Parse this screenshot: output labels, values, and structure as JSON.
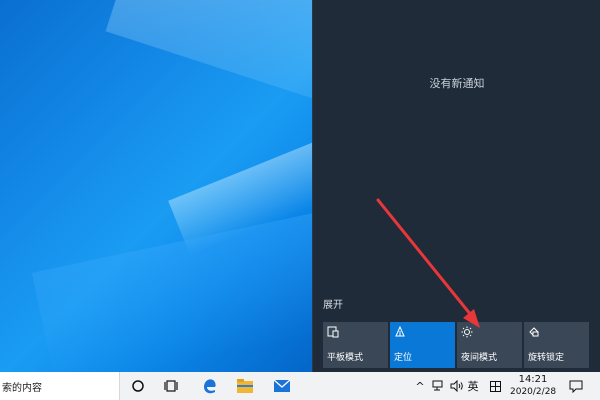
{
  "desktop": {},
  "action_center": {
    "empty_message": "没有新通知",
    "expand_label": "展开",
    "tiles": [
      {
        "label": "平板模式",
        "icon": "tablet-mode-icon",
        "active": false
      },
      {
        "label": "定位",
        "icon": "location-icon",
        "active": true
      },
      {
        "label": "夜间模式",
        "icon": "night-light-icon",
        "active": false
      },
      {
        "label": "旋转锁定",
        "icon": "rotation-lock-icon",
        "active": false
      }
    ]
  },
  "annotation": {
    "color": "#e8373a"
  },
  "taskbar": {
    "search_text": "索的内容",
    "apps": [
      "cortana-circle-icon",
      "task-view-icon",
      "edge-icon",
      "file-explorer-icon",
      "mail-icon"
    ],
    "tray": {
      "chevron": "^",
      "ime": "英",
      "time": "14:21",
      "date": "2020/2/28"
    }
  },
  "colors": {
    "accent": "#0a78d7",
    "panel": "#1f2b38",
    "tile": "#3a4756"
  }
}
